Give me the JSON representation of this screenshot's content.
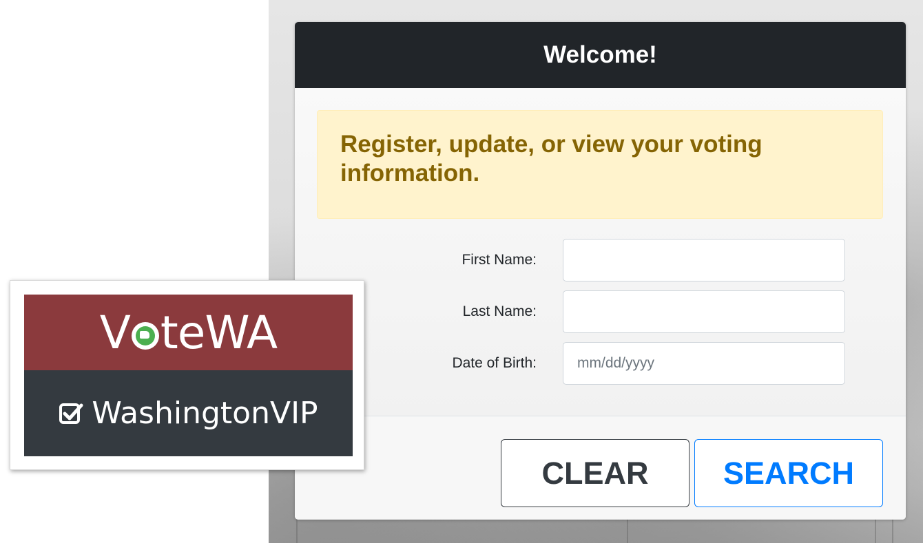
{
  "header": {
    "title": "Welcome!"
  },
  "alert": {
    "text": "Register, update, or view your voting information."
  },
  "form": {
    "first_name": {
      "label": "First Name:",
      "value": "",
      "placeholder": ""
    },
    "last_name": {
      "label": "Last Name:",
      "value": "",
      "placeholder": ""
    },
    "dob": {
      "label": "Date of Birth:",
      "value": "",
      "placeholder": "mm/dd/yyyy"
    }
  },
  "buttons": {
    "clear": "CLEAR",
    "search": "SEARCH"
  },
  "logo": {
    "brand_pre": "V",
    "brand_post": "teWA",
    "subtitle": "WashingtonVIP",
    "icons": [
      "washington-state-o-icon",
      "checkbox-icon"
    ]
  },
  "colors": {
    "header_bg": "#212529",
    "alert_bg": "#fff3cd",
    "alert_text": "#856404",
    "search_accent": "#007bff",
    "logo_red": "#8b3a3d",
    "logo_dark": "#343a40",
    "logo_green": "#4caf50"
  }
}
